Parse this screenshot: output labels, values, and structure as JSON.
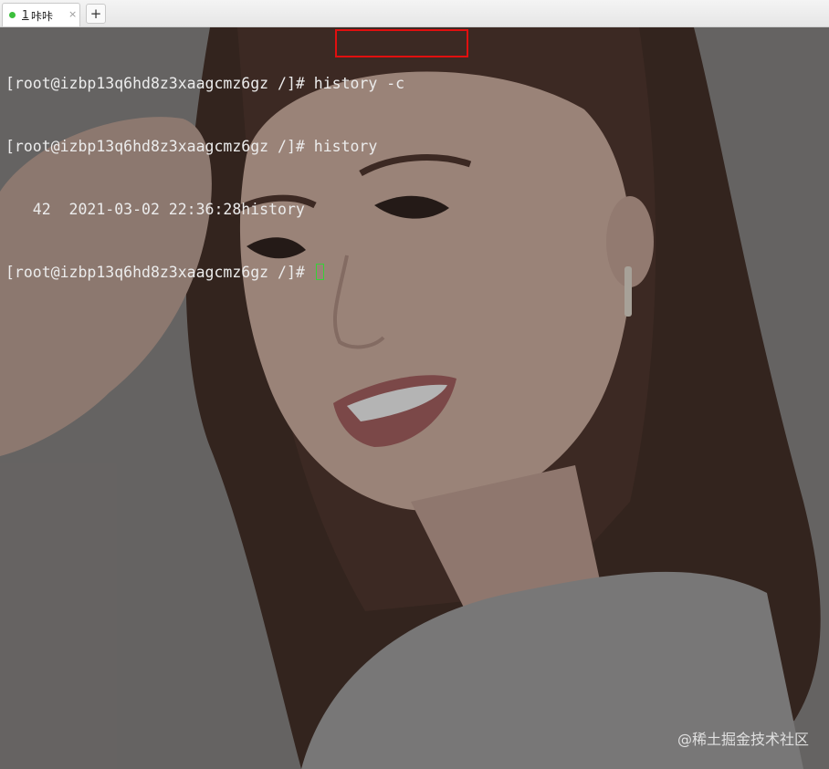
{
  "tabbar": {
    "tab": {
      "number": "1",
      "name": "咔咔",
      "close_label": "×",
      "status_color": "#3cbf3c"
    },
    "new_tab_label": "+"
  },
  "terminal": {
    "prompt": "[root@izbp13q6hd8z3xaagcmz6gz /]#",
    "lines": [
      {
        "prompt": "[root@izbp13q6hd8z3xaagcmz6gz /]#",
        "command": " history -c"
      },
      {
        "prompt": "[root@izbp13q6hd8z3xaagcmz6gz /]#",
        "command": " history"
      },
      {
        "output": "   42  2021-03-02 22:36:28history"
      },
      {
        "prompt": "[root@izbp13q6hd8z3xaagcmz6gz /]#",
        "command": " "
      }
    ],
    "highlight_color": "#e10f0f",
    "cursor_color": "#38d038",
    "text_color": "#ececec"
  },
  "watermark": "@稀土掘金技术社区"
}
